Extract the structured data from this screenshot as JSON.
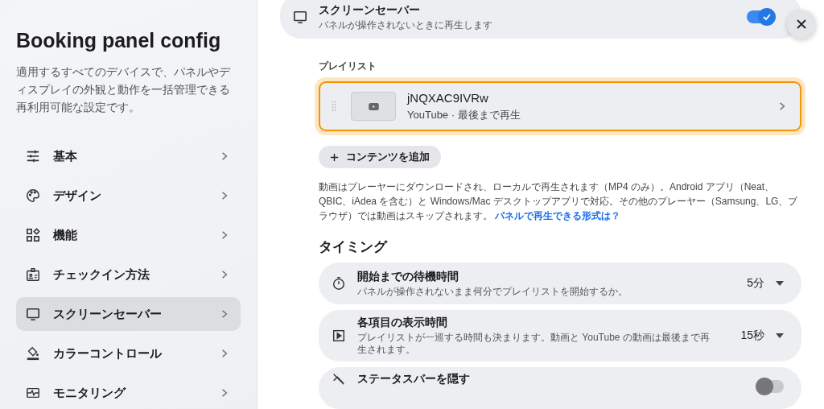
{
  "sidebar": {
    "title": "Booking panel config",
    "description": "適用するすべてのデバイスで、パネルやディスプレイの外観と動作を一括管理できる再利用可能な設定です。",
    "items": [
      {
        "label": "基本",
        "selected": false
      },
      {
        "label": "デザイン",
        "selected": false
      },
      {
        "label": "機能",
        "selected": false
      },
      {
        "label": "チェックイン方法",
        "selected": false
      },
      {
        "label": "スクリーンセーバー",
        "selected": true
      },
      {
        "label": "カラーコントロール",
        "selected": false
      },
      {
        "label": "モニタリング",
        "selected": false
      }
    ]
  },
  "screensaver": {
    "title": "スクリーンセーバー",
    "subtitle": "パネルが操作されないときに再生します",
    "on": true
  },
  "playlist": {
    "label": "プレイリスト",
    "items": [
      {
        "title": "jNQXAC9IVRw",
        "subtitle": "YouTube · 最後まで再生",
        "selected": true
      }
    ],
    "add_button": "コンテンツを追加",
    "note": "動画はプレーヤーにダウンロードされ、ローカルで再生されます（MP4 のみ）。Android アプリ（Neat、QBIC、iAdea を含む）と Windows/Mac デスクトップアプリで対応。その他のプレーヤー（Samsung、LG、ブラウザ）では動画はスキップされます。",
    "note_link": "パネルで再生できる形式は？"
  },
  "timing": {
    "heading": "タイミング",
    "rows": [
      {
        "kind": "select",
        "title": "開始までの待機時間",
        "subtitle": "パネルが操作されないまま何分でプレイリストを開始するか。",
        "value": "5分"
      },
      {
        "kind": "select",
        "title": "各項目の表示時間",
        "subtitle": "プレイリストが一巡する時間も決まります。動画と YouTube の動画は最後まで再生されます。",
        "value": "15秒"
      },
      {
        "kind": "toggle",
        "title": "ステータスバーを隠す",
        "on": false
      }
    ]
  }
}
